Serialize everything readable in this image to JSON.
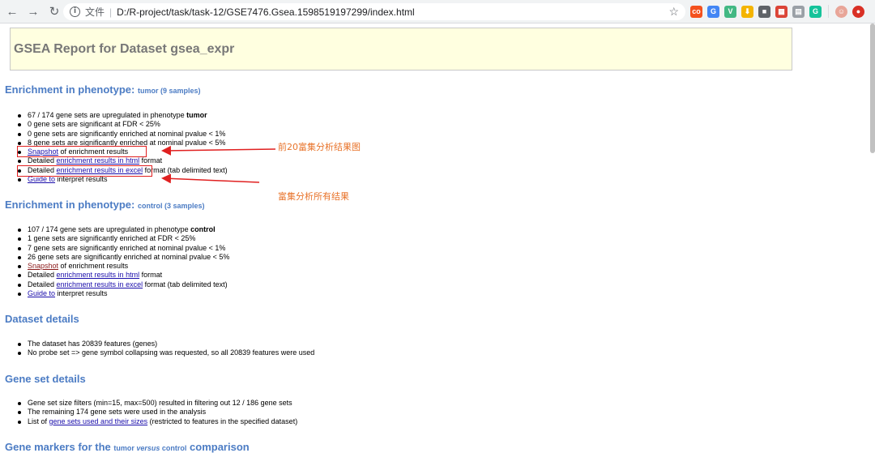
{
  "browser": {
    "address": {
      "scheme": "文件",
      "url": "D:/R-project/task/task-12/GSE7476.Gsea.1598519197299/index.html"
    },
    "nav": {
      "back": "←",
      "forward": "→",
      "reload": "↻",
      "star": "☆"
    },
    "extensions": [
      {
        "name": "ext-1",
        "label": "co",
        "color": "#f4511e"
      },
      {
        "name": "ext-translate",
        "label": "G",
        "color": "#4285f4"
      },
      {
        "name": "ext-vue",
        "label": "V",
        "color": "#42b883"
      },
      {
        "name": "ext-4",
        "label": "⬇",
        "color": "#f4b400"
      },
      {
        "name": "ext-bookmark",
        "label": "■",
        "color": "#5f6368"
      },
      {
        "name": "ext-palette",
        "label": "▦",
        "color": "#db4437"
      },
      {
        "name": "ext-doc",
        "label": "▤",
        "color": "#9aa0a6"
      },
      {
        "name": "ext-grammarly",
        "label": "G",
        "color": "#15c39a"
      },
      {
        "name": "ext-avatar",
        "label": "☺",
        "color": "#e8a598"
      },
      {
        "name": "ext-update",
        "label": "●",
        "color": "#d93025"
      }
    ]
  },
  "page_title": "GSEA Report for Dataset gsea_expr",
  "tumor_section": {
    "heading": "Enrichment in phenotype: ",
    "sub": "tumor (9 samples)",
    "items": {
      "upregulated_pre": "67 / 174 gene sets are upregulated in phenotype ",
      "upregulated_phen": "tumor",
      "fdr": "0 gene sets are significant at FDR < 25%",
      "nominal1": "0 gene sets are significantly enriched at nominal pvalue < 1%",
      "nominal5": "8 gene sets are significantly enriched at nominal pvalue < 5%",
      "snapshot_link": "Snapshot",
      "snapshot_rest": " of enrichment results",
      "html_pre": "Detailed ",
      "html_link": "enrichment results in html",
      "html_rest": " format",
      "excel_pre": "Detailed ",
      "excel_link": "enrichment results in excel",
      "excel_rest": " format (tab delimited text)",
      "guide_link": "Guide to",
      "guide_rest": " interpret results"
    }
  },
  "control_section": {
    "heading": "Enrichment in phenotype: ",
    "sub": "control (3 samples)",
    "items": {
      "upregulated_pre": "107 / 174 gene sets are upregulated in phenotype ",
      "upregulated_phen": "control",
      "fdr": "1 gene sets are significantly enriched at FDR < 25%",
      "nominal1": "7 gene sets are significantly enriched at nominal pvalue < 1%",
      "nominal5": "26 gene sets are significantly enriched at nominal pvalue < 5%",
      "snapshot_link": "Snapshot",
      "snapshot_rest": " of enrichment results",
      "html_pre": "Detailed ",
      "html_link": "enrichment results in html",
      "html_rest": " format",
      "excel_pre": "Detailed ",
      "excel_link": "enrichment results in excel",
      "excel_rest": " format (tab delimited text)",
      "guide_link": "Guide to",
      "guide_rest": " interpret results"
    }
  },
  "dataset_section": {
    "heading": "Dataset details",
    "items": [
      "The dataset has 20839 features (genes)",
      "No probe set => gene symbol collapsing was requested, so all 20839 features were used"
    ]
  },
  "geneset_section": {
    "heading": "Gene set details",
    "item1": "Gene set size filters (min=15, max=500) resulted in filtering out 12 / 186 gene sets",
    "item2": "The remaining 174 gene sets were used in the analysis",
    "item3_pre": "List of ",
    "item3_link": "gene sets used and their sizes",
    "item3_rest": " (restricted to features in the specified dataset)"
  },
  "markers_section": {
    "heading_pre": "Gene markers for the ",
    "sub_a": "tumor",
    "sub_versus": " versus ",
    "sub_b": "control",
    "heading_post": " comparison"
  },
  "annotations": {
    "top20": "前20富集分析结果图",
    "all_results": "富集分析所有结果"
  },
  "colors": {
    "heading_blue": "#4c7cc4",
    "title_bg": "#ffffe0",
    "annotation_red": "#e02020",
    "annotation_orange": "#e8732a"
  }
}
